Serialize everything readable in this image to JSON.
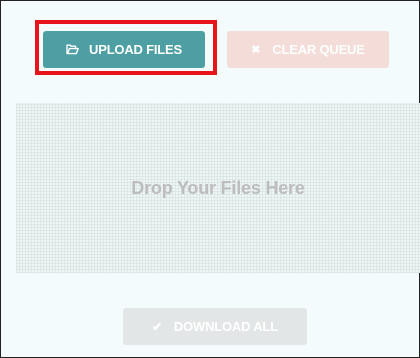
{
  "toolbar": {
    "upload_label": "UPLOAD FILES",
    "upload_icon": "folder-open-icon",
    "clear_label": "CLEAR QUEUE",
    "clear_icon": "close-icon"
  },
  "dropzone": {
    "text": "Drop Your Files Here"
  },
  "footer": {
    "download_label": "DOWNLOAD ALL",
    "download_icon": "check-icon"
  },
  "colors": {
    "primary": "#4d9fa3",
    "danger_disabled": "#f4ddd8",
    "disabled": "#e2e6e6",
    "highlight": "#e8141c",
    "background": "#f4fbfd"
  }
}
